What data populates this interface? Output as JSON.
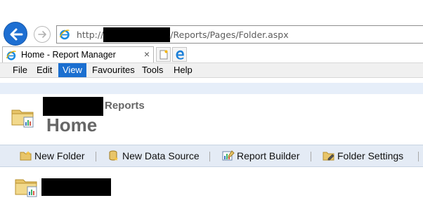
{
  "browser": {
    "address": {
      "scheme": "http://",
      "path": "/Reports/Pages/Folder.aspx"
    },
    "tab": {
      "title": "Home - Report Manager",
      "close_glyph": "×"
    },
    "menu": [
      "File",
      "Edit",
      "View",
      "Favourites",
      "Tools",
      "Help"
    ],
    "active_menu": "View",
    "colors": {
      "accent": "#1b6fd0"
    }
  },
  "page": {
    "breadcrumb": "Reports",
    "title": "Home",
    "toolbar": {
      "new_folder": "New Folder",
      "new_data_source": "New Data Source",
      "report_builder": "Report Builder",
      "folder_settings": "Folder Settings"
    },
    "icons": [
      "folder-icon",
      "data-source-icon",
      "report-builder-icon",
      "folder-settings-icon"
    ]
  }
}
